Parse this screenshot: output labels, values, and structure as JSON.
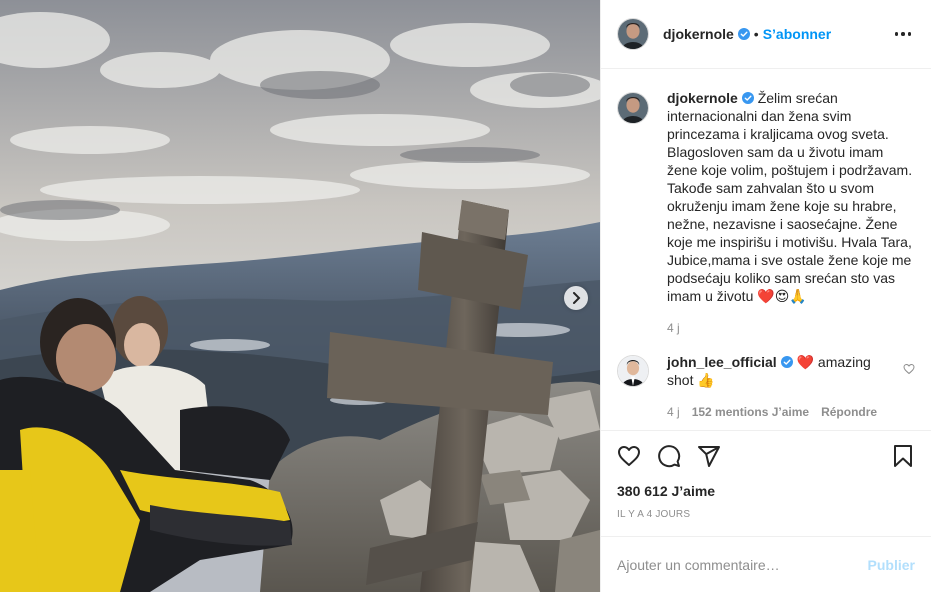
{
  "photo": {
    "alt_icon": "chevron-right-icon"
  },
  "header": {
    "username": "djokernole",
    "separator": "•",
    "follow_label": "S’abonner",
    "verified_icon": "verified-badge-icon",
    "more_icon": "more-options-icon"
  },
  "caption": {
    "username": "djokernole",
    "text": "Želim srećan internacionalni dan žena svim princezama i kraljicama ovog sveta. Blagosloven sam da u životu imam žene koje volim, poštujem i podržavam. Takođe sam zahvalan što u svom okruženju imam žene koje su hrabre, nežne, nezavisne i saosećajne. Žene koje me inspirišu i motivišu. Hvala Tara, Jubice,mama i sve ostale žene koje me podsećaju koliko sam srećan sto vas imam u životu",
    "emojis": [
      "❤️",
      "😍",
      "🙏"
    ],
    "time": "4 j"
  },
  "comments": [
    {
      "username": "john_lee_official",
      "heart": "❤️",
      "text": "amazing shot",
      "emoji": "👍",
      "time": "4 j",
      "likes": "152 mentions J’aime",
      "reply_label": "Répondre"
    }
  ],
  "actions": {
    "like_icon": "heart-icon",
    "comment_icon": "comment-icon",
    "share_icon": "share-icon",
    "save_icon": "bookmark-icon",
    "likes_count": "380 612 J’aime",
    "time_ago": "IL Y A 4 JOURS"
  },
  "add_comment": {
    "placeholder": "Ajouter un commentaire…",
    "publish_label": "Publier"
  }
}
